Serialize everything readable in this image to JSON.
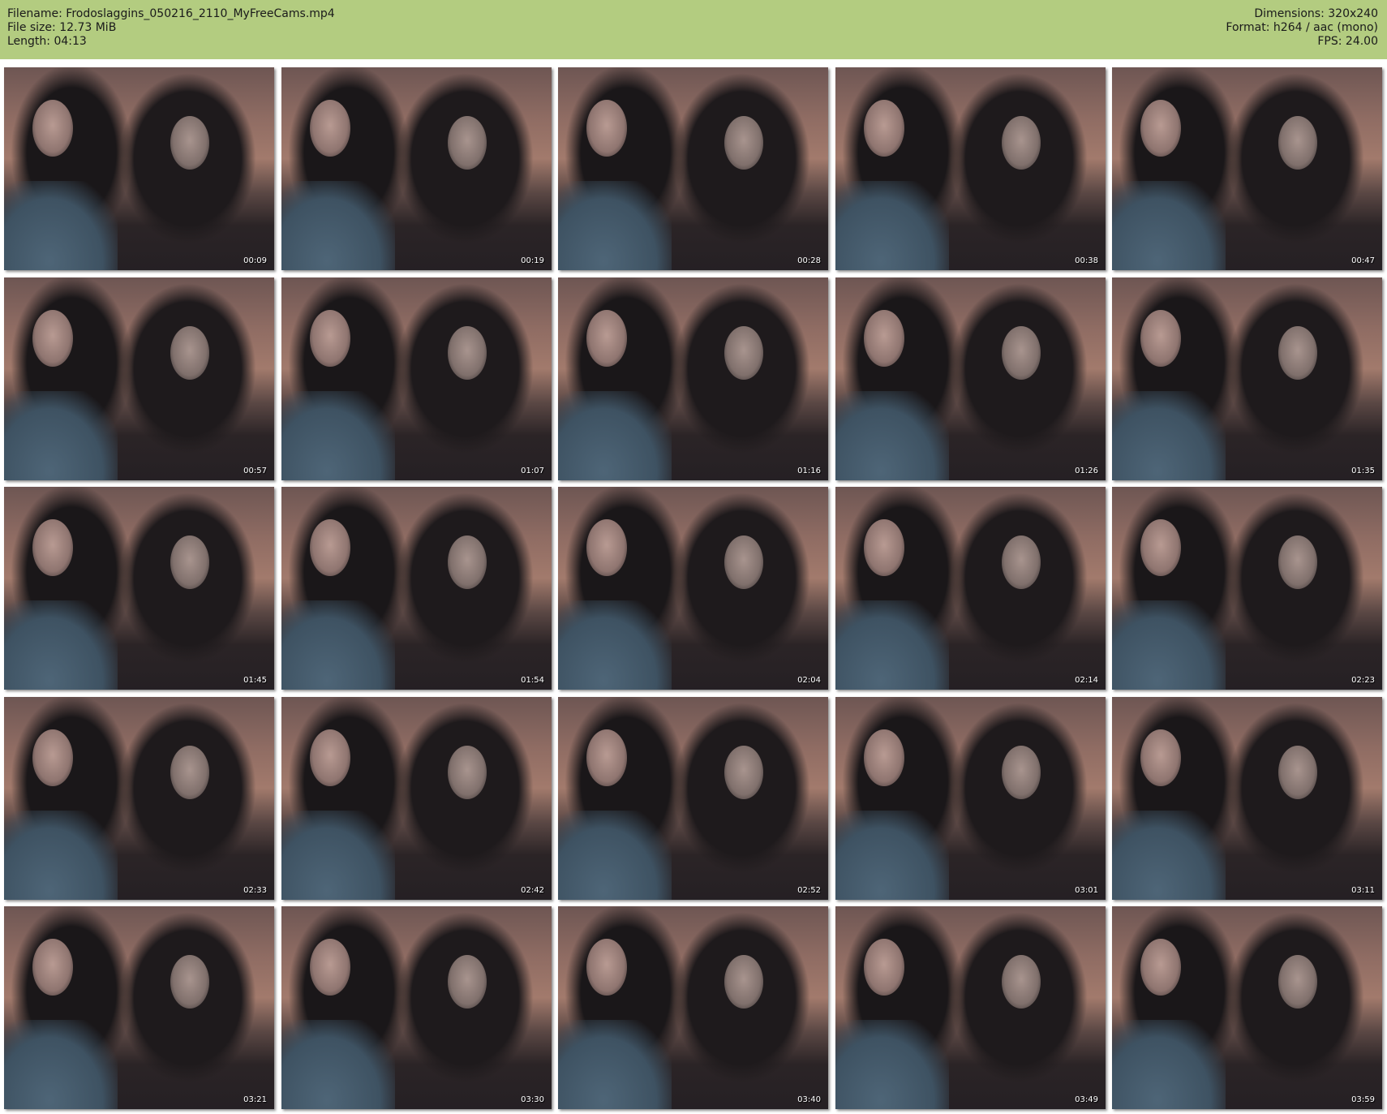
{
  "header": {
    "filename": "Filename: Frodoslaggins_050216_2110_MyFreeCams.mp4",
    "filesize": "File size: 12.73 MiB",
    "length": "Length: 04:13",
    "dimensions": "Dimensions: 320x240",
    "format": "Format: h264 / aac (mono)",
    "fps": "FPS: 24.00"
  },
  "colors": {
    "header_bg": "#b3cc80",
    "page_bg": "#ffffff"
  },
  "thumbnails": [
    "00:09",
    "00:19",
    "00:28",
    "00:38",
    "00:47",
    "00:57",
    "01:07",
    "01:16",
    "01:26",
    "01:35",
    "01:45",
    "01:54",
    "02:04",
    "02:14",
    "02:23",
    "02:33",
    "02:42",
    "02:52",
    "03:01",
    "03:11",
    "03:21",
    "03:30",
    "03:40",
    "03:49",
    "03:59"
  ]
}
